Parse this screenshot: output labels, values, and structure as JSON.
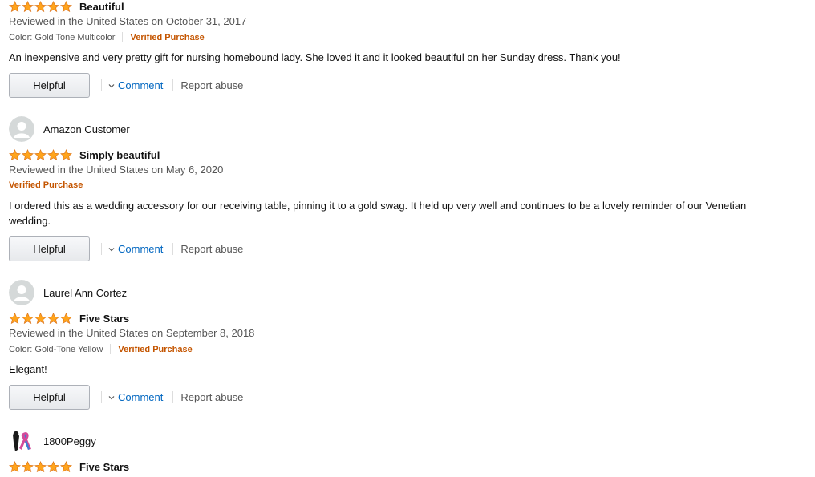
{
  "colors": {
    "star": "#ffa41c",
    "verified": "#c45500",
    "link": "#0066c0"
  },
  "actions": {
    "helpful": "Helpful",
    "comment": "Comment",
    "report": "Report abuse"
  },
  "reviews": [
    {
      "rating": 5,
      "title": "Beautiful",
      "date": "Reviewed in the United States on October 31, 2017",
      "variant": "Color: Gold Tone Multicolor",
      "verified": "Verified Purchase",
      "body": "An inexpensive and very pretty gift for nursing homebound lady. She loved it and it looked beautiful on her Sunday dress. Thank you!"
    },
    {
      "reviewer": "Amazon Customer",
      "avatar": "default-avatar-icon",
      "rating": 5,
      "title": "Simply beautiful",
      "date": "Reviewed in the United States on May 6, 2020",
      "verified": "Verified Purchase",
      "body": "I ordered this as a wedding accessory for our receiving table, pinning it to a gold swag. It held up very well and continues to be a lovely reminder of our Venetian wedding."
    },
    {
      "reviewer": "Laurel Ann Cortez",
      "avatar": "default-avatar-icon",
      "rating": 5,
      "title": "Five Stars",
      "date": "Reviewed in the United States on September 8, 2018",
      "variant": "Color: Gold-Tone Yellow",
      "verified": "Verified Purchase",
      "body": "Elegant!"
    },
    {
      "reviewer": "1800Peggy",
      "avatar": "ribbon-profile-avatar",
      "rating": 5,
      "title": "Five Stars"
    }
  ]
}
